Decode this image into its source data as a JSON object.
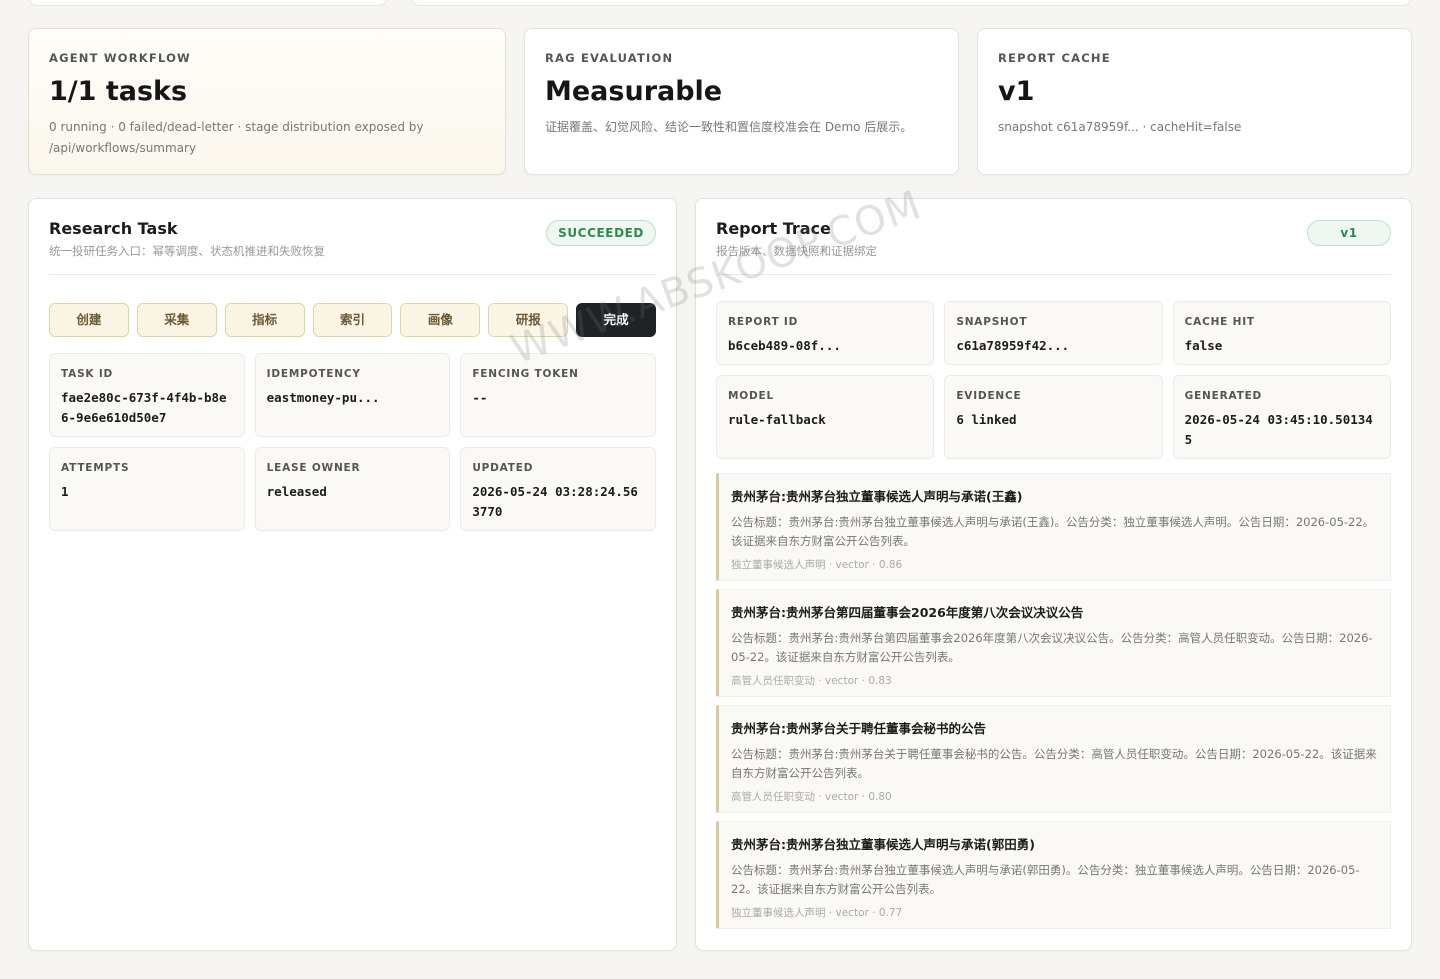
{
  "summary_cards": [
    {
      "label": "AGENT WORKFLOW",
      "value": "1/1 tasks",
      "desc": "0 running · 0 failed/dead-letter · stage distribution exposed by /api/workflows/summary"
    },
    {
      "label": "RAG EVALUATION",
      "value": "Measurable",
      "desc": "证据覆盖、幻觉风险、结论一致性和置信度校准会在 Demo 后展示。"
    },
    {
      "label": "REPORT CACHE",
      "value": "v1",
      "desc": "snapshot c61a78959f... · cacheHit=false"
    }
  ],
  "research_task": {
    "title": "Research Task",
    "subtitle": "统一投研任务入口：幂等调度、状态机推进和失败恢复",
    "status": "SUCCEEDED",
    "stages": [
      "创建",
      "采集",
      "指标",
      "索引",
      "画像",
      "研报",
      "完成"
    ],
    "fields": [
      {
        "key": "TASK ID",
        "value": "fae2e80c-673f-4f4b-b8e6-9e6e610d50e7"
      },
      {
        "key": "IDEMPOTENCY",
        "value": "eastmoney-pu..."
      },
      {
        "key": "FENCING TOKEN",
        "value": "--"
      },
      {
        "key": "ATTEMPTS",
        "value": "1"
      },
      {
        "key": "LEASE OWNER",
        "value": "released"
      },
      {
        "key": "UPDATED",
        "value": "2026-05-24 03:28:24.563770"
      }
    ]
  },
  "report_trace": {
    "title": "Report Trace",
    "subtitle": "报告版本、数据快照和证据绑定",
    "version": "v1",
    "fields": [
      {
        "key": "REPORT ID",
        "value": "b6ceb489-08f..."
      },
      {
        "key": "SNAPSHOT",
        "value": "c61a78959f42..."
      },
      {
        "key": "CACHE HIT",
        "value": "false"
      },
      {
        "key": "MODEL",
        "value": "rule-fallback"
      },
      {
        "key": "EVIDENCE",
        "value": "6 linked"
      },
      {
        "key": "GENERATED",
        "value": "2026-05-24 03:45:10.501345"
      }
    ],
    "evidence": [
      {
        "title": "贵州茅台:贵州茅台独立董事候选人声明与承诺(王鑫)",
        "desc": "公告标题：贵州茅台:贵州茅台独立董事候选人声明与承诺(王鑫)。公告分类：独立董事候选人声明。公告日期：2026-05-22。该证据来自东方财富公开公告列表。",
        "meta": "独立董事候选人声明 · vector · 0.86"
      },
      {
        "title": "贵州茅台:贵州茅台第四届董事会2026年度第八次会议决议公告",
        "desc": "公告标题：贵州茅台:贵州茅台第四届董事会2026年度第八次会议决议公告。公告分类：高管人员任职变动。公告日期：2026-05-22。该证据来自东方财富公开公告列表。",
        "meta": "高管人员任职变动 · vector · 0.83"
      },
      {
        "title": "贵州茅台:贵州茅台关于聘任董事会秘书的公告",
        "desc": "公告标题：贵州茅台:贵州茅台关于聘任董事会秘书的公告。公告分类：高管人员任职变动。公告日期：2026-05-22。该证据来自东方财富公开公告列表。",
        "meta": "高管人员任职变动 · vector · 0.80"
      },
      {
        "title": "贵州茅台:贵州茅台独立董事候选人声明与承诺(郭田勇)",
        "desc": "公告标题：贵州茅台:贵州茅台独立董事候选人声明与承诺(郭田勇)。公告分类：独立董事候选人声明。公告日期：2026-05-22。该证据来自东方财富公开公告列表。",
        "meta": "独立董事候选人声明 · vector · 0.77"
      }
    ]
  },
  "watermark": "WWW.ABSKOOP.COM"
}
